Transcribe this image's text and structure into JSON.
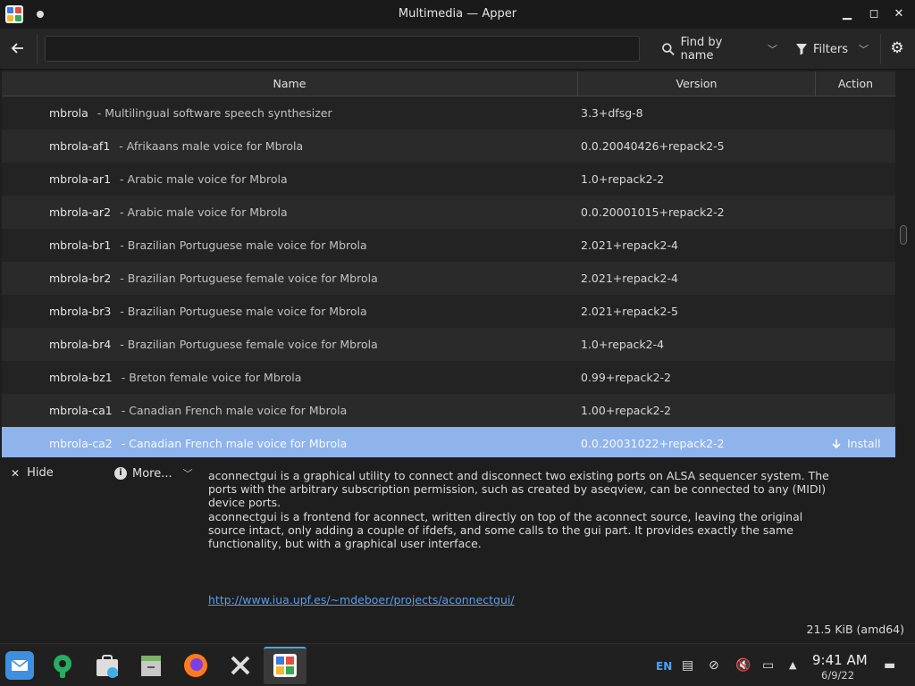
{
  "window": {
    "title": "Multimedia — Apper"
  },
  "toolbar": {
    "search_value": "",
    "find_label": "Find by name",
    "filters_label": "Filters"
  },
  "table": {
    "columns": [
      "Name",
      "Version",
      "Action"
    ],
    "rows": [
      {
        "name": "mbrola",
        "desc": "- Multilingual software speech synthesizer",
        "version": "3.3+dfsg-8",
        "action": ""
      },
      {
        "name": "mbrola-af1",
        "desc": "- Afrikaans male voice for Mbrola",
        "version": "0.0.20040426+repack2-5",
        "action": ""
      },
      {
        "name": "mbrola-ar1",
        "desc": "- Arabic male voice for Mbrola",
        "version": "1.0+repack2-2",
        "action": ""
      },
      {
        "name": "mbrola-ar2",
        "desc": "- Arabic male voice for Mbrola",
        "version": "0.0.20001015+repack2-2",
        "action": ""
      },
      {
        "name": "mbrola-br1",
        "desc": "- Brazilian Portuguese male voice for Mbrola",
        "version": "2.021+repack2-4",
        "action": ""
      },
      {
        "name": "mbrola-br2",
        "desc": "- Brazilian Portuguese female voice for Mbrola",
        "version": "2.021+repack2-4",
        "action": ""
      },
      {
        "name": "mbrola-br3",
        "desc": "- Brazilian Portuguese male voice for Mbrola",
        "version": "2.021+repack2-5",
        "action": ""
      },
      {
        "name": "mbrola-br4",
        "desc": "- Brazilian Portuguese female voice for Mbrola",
        "version": "1.0+repack2-4",
        "action": ""
      },
      {
        "name": "mbrola-bz1",
        "desc": "- Breton female voice for Mbrola",
        "version": "0.99+repack2-2",
        "action": ""
      },
      {
        "name": "mbrola-ca1",
        "desc": "- Canadian French male voice for Mbrola",
        "version": "1.00+repack2-2",
        "action": ""
      },
      {
        "name": "mbrola-ca2",
        "desc": "- Canadian French male voice for Mbrola",
        "version": "0.0.20031022+repack2-2",
        "action": "Install",
        "selected": true
      }
    ]
  },
  "details": {
    "hide_label": "Hide",
    "more_label": "More...",
    "description_p1": "aconnectgui is a graphical utility to connect and disconnect two existing ports on ALSA sequencer system. The ports with the arbitrary subscription permission, such as created by aseqview, can be connected to any (MIDI) device ports.",
    "description_p2": "aconnectgui is a frontend for aconnect, written directly on top of the aconnect source, leaving the original source intact, only adding a couple of ifdefs, and some calls to the gui part. It provides exactly the same functionality, but with a graphical user interface.",
    "homepage": "http://www.iua.upf.es/~mdeboer/projects/aconnectgui/",
    "size": "21.5 KiB (amd64)"
  },
  "taskbar": {
    "apps": [
      "mail-icon",
      "settings-wrench-icon",
      "discover-store-icon",
      "file-manager-icon",
      "firefox-icon",
      "x-app-icon",
      "apper-icon"
    ],
    "language": "EN",
    "time": "9:41 AM",
    "date": "6/9/22"
  },
  "colors": {
    "selection": "#8fb4ec",
    "link": "#5d9ce8",
    "language": "#4aa3ff"
  }
}
